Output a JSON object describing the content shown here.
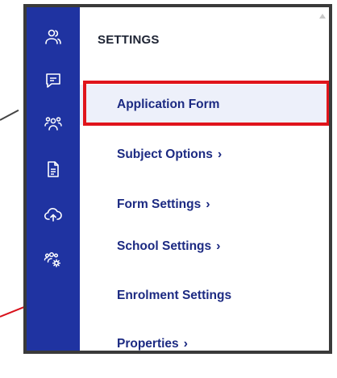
{
  "sidebar": {
    "icons": [
      {
        "name": "users-icon"
      },
      {
        "name": "message-icon"
      },
      {
        "name": "group-icon"
      },
      {
        "name": "document-icon"
      },
      {
        "name": "cloud-upload-icon"
      },
      {
        "name": "group-settings-icon"
      }
    ],
    "icon_color": "#ffffff",
    "background": "#1f33a1"
  },
  "settings": {
    "title": "SETTINGS",
    "items": [
      {
        "label": "Application Form",
        "chevron": "",
        "active": true
      },
      {
        "label": "Subject Options",
        "chevron": "›"
      },
      {
        "label": "Form Settings",
        "chevron": "›"
      },
      {
        "label": "School Settings",
        "chevron": "›"
      },
      {
        "label": "Enrolment Settings",
        "chevron": ""
      },
      {
        "label": "Properties",
        "chevron": "›"
      }
    ]
  },
  "colors": {
    "accent": "#1c2a82",
    "highlight": "#e0141b",
    "active_bg": "#edf0fa"
  }
}
